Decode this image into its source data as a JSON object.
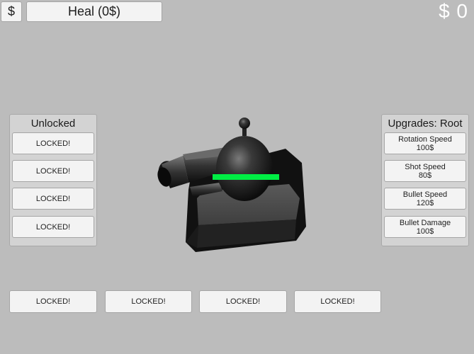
{
  "top_bar": {
    "shop_button": "$",
    "heal_button": "Heal (0$)",
    "money_display": "$ 0"
  },
  "unlocked_panel": {
    "title": "Unlocked",
    "items": [
      "LOCKED!",
      "LOCKED!",
      "LOCKED!",
      "LOCKED!"
    ]
  },
  "upgrades_panel": {
    "title": "Upgrades: Root",
    "items": [
      {
        "name": "Rotation Speed",
        "price": "100$"
      },
      {
        "name": "Shot Speed",
        "price": "80$"
      },
      {
        "name": "Bullet Speed",
        "price": "120$"
      },
      {
        "name": "Bullet Damage",
        "price": "100$"
      }
    ]
  },
  "bottom_slots": [
    "LOCKED!",
    "LOCKED!",
    "LOCKED!",
    "LOCKED!"
  ],
  "player": {
    "health_fraction": 1.0,
    "health_color": "#00ee44"
  }
}
